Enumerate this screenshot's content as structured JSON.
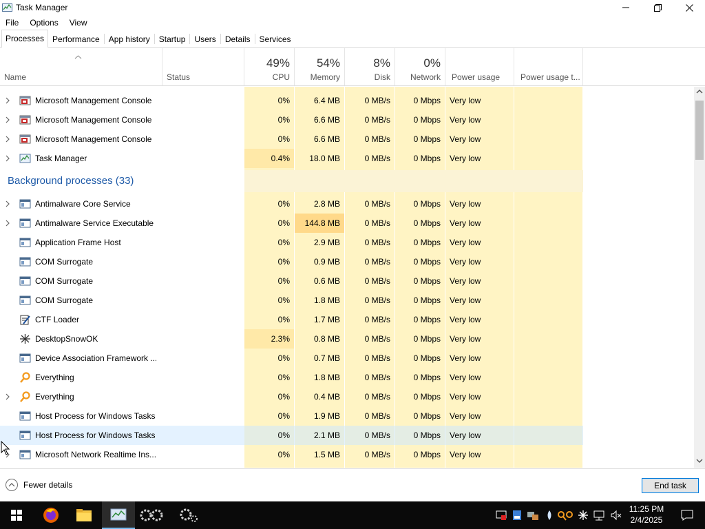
{
  "window": {
    "title": "Task Manager"
  },
  "menu": [
    "File",
    "Options",
    "View"
  ],
  "tabs": [
    "Processes",
    "Performance",
    "App history",
    "Startup",
    "Users",
    "Details",
    "Services"
  ],
  "header": {
    "name": "Name",
    "status": "Status",
    "cpu_pct": "49%",
    "cpu": "CPU",
    "memory_pct": "54%",
    "memory": "Memory",
    "disk_pct": "8%",
    "disk": "Disk",
    "network_pct": "0%",
    "network": "Network",
    "power": "Power usage",
    "power_trend": "Power usage t..."
  },
  "apps": [
    {
      "name": "Microsoft Management Console",
      "icon": "mmc-icon",
      "expandable": true,
      "cpu": "0%",
      "mem": "6.4 MB",
      "disk": "0 MB/s",
      "net": "0 Mbps",
      "power": "Very low"
    },
    {
      "name": "Microsoft Management Console",
      "icon": "mmc-icon",
      "expandable": true,
      "cpu": "0%",
      "mem": "6.6 MB",
      "disk": "0 MB/s",
      "net": "0 Mbps",
      "power": "Very low"
    },
    {
      "name": "Microsoft Management Console",
      "icon": "mmc-icon",
      "expandable": true,
      "cpu": "0%",
      "mem": "6.6 MB",
      "disk": "0 MB/s",
      "net": "0 Mbps",
      "power": "Very low"
    },
    {
      "name": "Task Manager",
      "icon": "task-manager-icon",
      "expandable": true,
      "cpu": "0.4%",
      "mem": "18.0 MB",
      "disk": "0 MB/s",
      "net": "0 Mbps",
      "power": "Very low"
    }
  ],
  "background_group": "Background processes (33)",
  "background": [
    {
      "name": "Antimalware Core Service",
      "icon": "window-icon",
      "expandable": true,
      "cpu": "0%",
      "mem": "2.8 MB",
      "disk": "0 MB/s",
      "net": "0 Mbps",
      "power": "Very low"
    },
    {
      "name": "Antimalware Service Executable",
      "icon": "window-icon",
      "expandable": true,
      "cpu": "0%",
      "mem": "144.8 MB",
      "disk": "0 MB/s",
      "net": "0 Mbps",
      "power": "Very low"
    },
    {
      "name": "Application Frame Host",
      "icon": "window-icon",
      "expandable": false,
      "cpu": "0%",
      "mem": "2.9 MB",
      "disk": "0 MB/s",
      "net": "0 Mbps",
      "power": "Very low"
    },
    {
      "name": "COM Surrogate",
      "icon": "window-icon",
      "expandable": false,
      "cpu": "0%",
      "mem": "0.9 MB",
      "disk": "0 MB/s",
      "net": "0 Mbps",
      "power": "Very low"
    },
    {
      "name": "COM Surrogate",
      "icon": "window-icon",
      "expandable": false,
      "cpu": "0%",
      "mem": "0.6 MB",
      "disk": "0 MB/s",
      "net": "0 Mbps",
      "power": "Very low"
    },
    {
      "name": "COM Surrogate",
      "icon": "window-icon",
      "expandable": false,
      "cpu": "0%",
      "mem": "1.8 MB",
      "disk": "0 MB/s",
      "net": "0 Mbps",
      "power": "Very low"
    },
    {
      "name": "CTF Loader",
      "icon": "ctf-loader-icon",
      "expandable": false,
      "cpu": "0%",
      "mem": "1.7 MB",
      "disk": "0 MB/s",
      "net": "0 Mbps",
      "power": "Very low"
    },
    {
      "name": "DesktopSnowOK",
      "icon": "snowflake-icon",
      "expandable": false,
      "cpu": "2.3%",
      "mem": "0.8 MB",
      "disk": "0 MB/s",
      "net": "0 Mbps",
      "power": "Very low"
    },
    {
      "name": "Device Association Framework ...",
      "icon": "window-icon",
      "expandable": false,
      "cpu": "0%",
      "mem": "0.7 MB",
      "disk": "0 MB/s",
      "net": "0 Mbps",
      "power": "Very low"
    },
    {
      "name": "Everything",
      "icon": "magnifier-icon",
      "expandable": false,
      "cpu": "0%",
      "mem": "1.8 MB",
      "disk": "0 MB/s",
      "net": "0 Mbps",
      "power": "Very low"
    },
    {
      "name": "Everything",
      "icon": "magnifier-icon",
      "expandable": true,
      "cpu": "0%",
      "mem": "0.4 MB",
      "disk": "0 MB/s",
      "net": "0 Mbps",
      "power": "Very low"
    },
    {
      "name": "Host Process for Windows Tasks",
      "icon": "window-icon",
      "expandable": false,
      "cpu": "0%",
      "mem": "1.9 MB",
      "disk": "0 MB/s",
      "net": "0 Mbps",
      "power": "Very low"
    },
    {
      "name": "Host Process for Windows Tasks",
      "icon": "window-icon",
      "expandable": false,
      "cpu": "0%",
      "mem": "2.1 MB",
      "disk": "0 MB/s",
      "net": "0 Mbps",
      "power": "Very low"
    },
    {
      "name": "Microsoft Network Realtime Ins...",
      "icon": "window-icon",
      "expandable": true,
      "cpu": "0%",
      "mem": "1.5 MB",
      "disk": "0 MB/s",
      "net": "0 Mbps",
      "power": "Very low"
    }
  ],
  "footer": {
    "fewer_details": "Fewer details",
    "end_task": "End task"
  },
  "taskbar": {
    "time": "11:25 PM",
    "date": "2/4/2025"
  },
  "colors": {
    "heat_light": "#fff4c4",
    "heat_medium": "#ffe9a8",
    "heat_strong": "#ffd98a",
    "accent": "#0078d7",
    "group_title": "#1e5aa8"
  }
}
